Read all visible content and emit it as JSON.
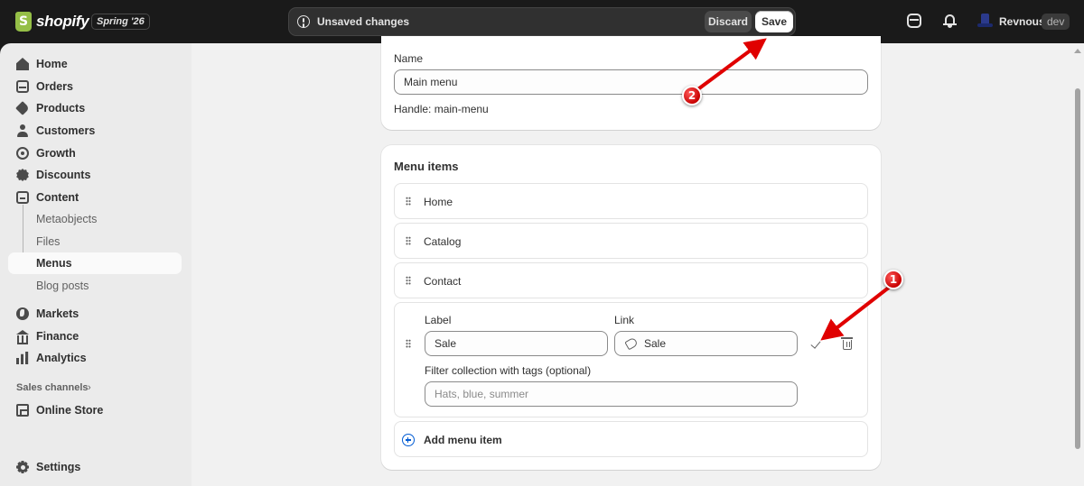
{
  "topbar": {
    "logo_text": "shopify",
    "edition": "Spring '26",
    "unsaved_message": "Unsaved changes",
    "discard_label": "Discard",
    "save_label": "Save",
    "user_name": "Revnous",
    "env_badge": "dev"
  },
  "sidebar": {
    "items": [
      {
        "label": "Home",
        "icon": "home-icon"
      },
      {
        "label": "Orders",
        "icon": "orders-icon"
      },
      {
        "label": "Products",
        "icon": "tag-icon"
      },
      {
        "label": "Customers",
        "icon": "person-icon"
      },
      {
        "label": "Growth",
        "icon": "growth-icon"
      },
      {
        "label": "Discounts",
        "icon": "discount-icon"
      },
      {
        "label": "Content",
        "icon": "content-icon"
      }
    ],
    "content_sub": [
      "Metaobjects",
      "Files",
      "Menus",
      "Blog posts"
    ],
    "items2": [
      {
        "label": "Markets",
        "icon": "globe-icon"
      },
      {
        "label": "Finance",
        "icon": "bank-icon"
      },
      {
        "label": "Analytics",
        "icon": "bar-chart-icon"
      }
    ],
    "sales_channels_label": "Sales channels",
    "online_store_label": "Online Store",
    "settings_label": "Settings"
  },
  "name_card": {
    "name_label": "Name",
    "name_value": "Main menu",
    "handle_text": "Handle: main-menu"
  },
  "menu_card": {
    "title": "Menu items",
    "items": [
      "Home",
      "Catalog",
      "Contact"
    ],
    "edit": {
      "label_caption": "Label",
      "label_value": "Sale",
      "link_caption": "Link",
      "link_value": "Sale",
      "filter_caption": "Filter collection with tags (optional)",
      "filter_placeholder": "Hats, blue, summer"
    },
    "add_label": "Add menu item"
  },
  "annotations": {
    "badge1": "1",
    "badge2": "2",
    "arrow_color": "#e00000"
  },
  "colors": {
    "topbar_bg": "#1a1a1a",
    "sidebar_bg": "#ebebeb",
    "main_bg": "#f1f1f1",
    "accent_blue": "#005bd3"
  }
}
